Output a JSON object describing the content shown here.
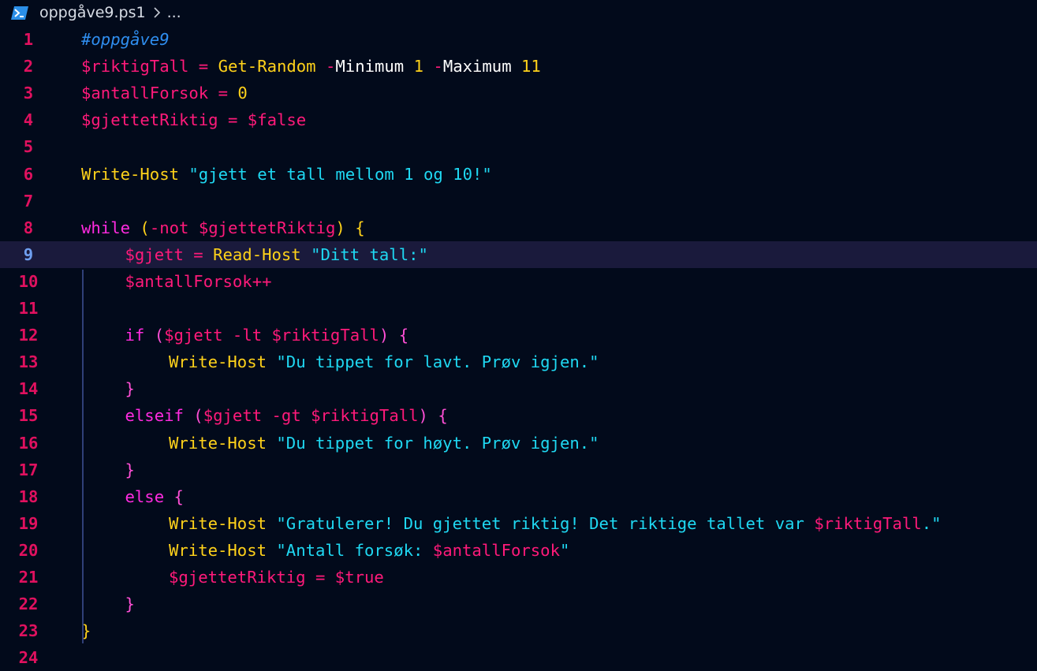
{
  "breadcrumb": {
    "icon": "powershell-icon",
    "file": "oppgåve9.ps1",
    "more": "..."
  },
  "colors": {
    "background": "#020a1b",
    "line_number": "#e0115f",
    "active_line_number": "#6f9ff0",
    "active_line_bg": "#1a1a3c",
    "variable": "#ff1a7a",
    "cmdlet": "#ffd21a",
    "string": "#1fd8f2",
    "keyword": "#ff2be0",
    "comment": "#2f8ef0"
  },
  "editor": {
    "active_line": 9,
    "lines": [
      {
        "num": "1",
        "indent": 0,
        "tokens": [
          {
            "t": "#oppgåve9",
            "c": "cmt"
          }
        ]
      },
      {
        "num": "2",
        "indent": 0,
        "tokens": [
          {
            "t": "$riktigTall",
            "c": "var"
          },
          {
            "t": " = ",
            "c": "op"
          },
          {
            "t": "Get-Random",
            "c": "cmd"
          },
          {
            "t": " ",
            "c": "plain"
          },
          {
            "t": "-",
            "c": "op"
          },
          {
            "t": "Minimum",
            "c": "plain"
          },
          {
            "t": " 1 ",
            "c": "num"
          },
          {
            "t": "-",
            "c": "op"
          },
          {
            "t": "Maximum",
            "c": "plain"
          },
          {
            "t": " 11",
            "c": "num"
          }
        ]
      },
      {
        "num": "3",
        "indent": 0,
        "tokens": [
          {
            "t": "$antallForsok",
            "c": "var"
          },
          {
            "t": " = ",
            "c": "op"
          },
          {
            "t": "0",
            "c": "num"
          }
        ]
      },
      {
        "num": "4",
        "indent": 0,
        "tokens": [
          {
            "t": "$gjettetRiktig",
            "c": "var"
          },
          {
            "t": " = ",
            "c": "op"
          },
          {
            "t": "$false",
            "c": "var"
          }
        ]
      },
      {
        "num": "5",
        "indent": 0,
        "tokens": []
      },
      {
        "num": "6",
        "indent": 0,
        "tokens": [
          {
            "t": "Write-Host",
            "c": "cmd"
          },
          {
            "t": " ",
            "c": "plain"
          },
          {
            "t": "\"gjett et tall mellom 1 og 10!\"",
            "c": "str"
          }
        ]
      },
      {
        "num": "7",
        "indent": 0,
        "tokens": []
      },
      {
        "num": "8",
        "indent": 0,
        "tokens": [
          {
            "t": "while",
            "c": "kw"
          },
          {
            "t": " (",
            "c": "br"
          },
          {
            "t": "-not",
            "c": "op"
          },
          {
            "t": " ",
            "c": "plain"
          },
          {
            "t": "$gjettetRiktig",
            "c": "var"
          },
          {
            "t": ") {",
            "c": "br"
          }
        ]
      },
      {
        "num": "9",
        "indent": 1,
        "tokens": [
          {
            "t": "$gjett",
            "c": "var"
          },
          {
            "t": " = ",
            "c": "op"
          },
          {
            "t": "Read-Host",
            "c": "cmd"
          },
          {
            "t": " ",
            "c": "plain"
          },
          {
            "t": "\"Ditt tall:\"",
            "c": "str"
          }
        ]
      },
      {
        "num": "10",
        "indent": 1,
        "tokens": [
          {
            "t": "$antallForsok",
            "c": "var"
          },
          {
            "t": "++",
            "c": "op"
          }
        ]
      },
      {
        "num": "11",
        "indent": 0,
        "tokens": []
      },
      {
        "num": "12",
        "indent": 1,
        "tokens": [
          {
            "t": "if",
            "c": "kw"
          },
          {
            "t": " (",
            "c": "par"
          },
          {
            "t": "$gjett",
            "c": "var"
          },
          {
            "t": " -lt ",
            "c": "op"
          },
          {
            "t": "$riktigTall",
            "c": "var"
          },
          {
            "t": ") {",
            "c": "par"
          }
        ]
      },
      {
        "num": "13",
        "indent": 2,
        "tokens": [
          {
            "t": "Write-Host",
            "c": "cmd"
          },
          {
            "t": " ",
            "c": "plain"
          },
          {
            "t": "\"Du tippet for lavt. Prøv igjen.\"",
            "c": "str"
          }
        ]
      },
      {
        "num": "14",
        "indent": 1,
        "tokens": [
          {
            "t": "}",
            "c": "par"
          }
        ]
      },
      {
        "num": "15",
        "indent": 1,
        "tokens": [
          {
            "t": "elseif",
            "c": "kw"
          },
          {
            "t": " (",
            "c": "par"
          },
          {
            "t": "$gjett",
            "c": "var"
          },
          {
            "t": " -gt ",
            "c": "op"
          },
          {
            "t": "$riktigTall",
            "c": "var"
          },
          {
            "t": ") {",
            "c": "par"
          }
        ]
      },
      {
        "num": "16",
        "indent": 2,
        "tokens": [
          {
            "t": "Write-Host",
            "c": "cmd"
          },
          {
            "t": " ",
            "c": "plain"
          },
          {
            "t": "\"Du tippet for høyt. Prøv igjen.\"",
            "c": "str"
          }
        ]
      },
      {
        "num": "17",
        "indent": 1,
        "tokens": [
          {
            "t": "}",
            "c": "par"
          }
        ]
      },
      {
        "num": "18",
        "indent": 1,
        "tokens": [
          {
            "t": "else",
            "c": "kw"
          },
          {
            "t": " {",
            "c": "par"
          }
        ]
      },
      {
        "num": "19",
        "indent": 2,
        "tokens": [
          {
            "t": "Write-Host",
            "c": "cmd"
          },
          {
            "t": " ",
            "c": "plain"
          },
          {
            "t": "\"Gratulerer! Du gjettet riktig! Det riktige tallet var ",
            "c": "str"
          },
          {
            "t": "$riktigTall",
            "c": "var"
          },
          {
            "t": ".\"",
            "c": "str"
          }
        ]
      },
      {
        "num": "20",
        "indent": 2,
        "tokens": [
          {
            "t": "Write-Host",
            "c": "cmd"
          },
          {
            "t": " ",
            "c": "plain"
          },
          {
            "t": "\"Antall forsøk: ",
            "c": "str"
          },
          {
            "t": "$antallForsok",
            "c": "var"
          },
          {
            "t": "\"",
            "c": "str"
          }
        ]
      },
      {
        "num": "21",
        "indent": 2,
        "tokens": [
          {
            "t": "$gjettetRiktig",
            "c": "var"
          },
          {
            "t": " = ",
            "c": "op"
          },
          {
            "t": "$true",
            "c": "var"
          }
        ]
      },
      {
        "num": "22",
        "indent": 1,
        "tokens": [
          {
            "t": "}",
            "c": "par"
          }
        ]
      },
      {
        "num": "23",
        "indent": 0,
        "tokens": [
          {
            "t": "}",
            "c": "br"
          }
        ]
      },
      {
        "num": "24",
        "indent": 0,
        "tokens": []
      }
    ]
  }
}
